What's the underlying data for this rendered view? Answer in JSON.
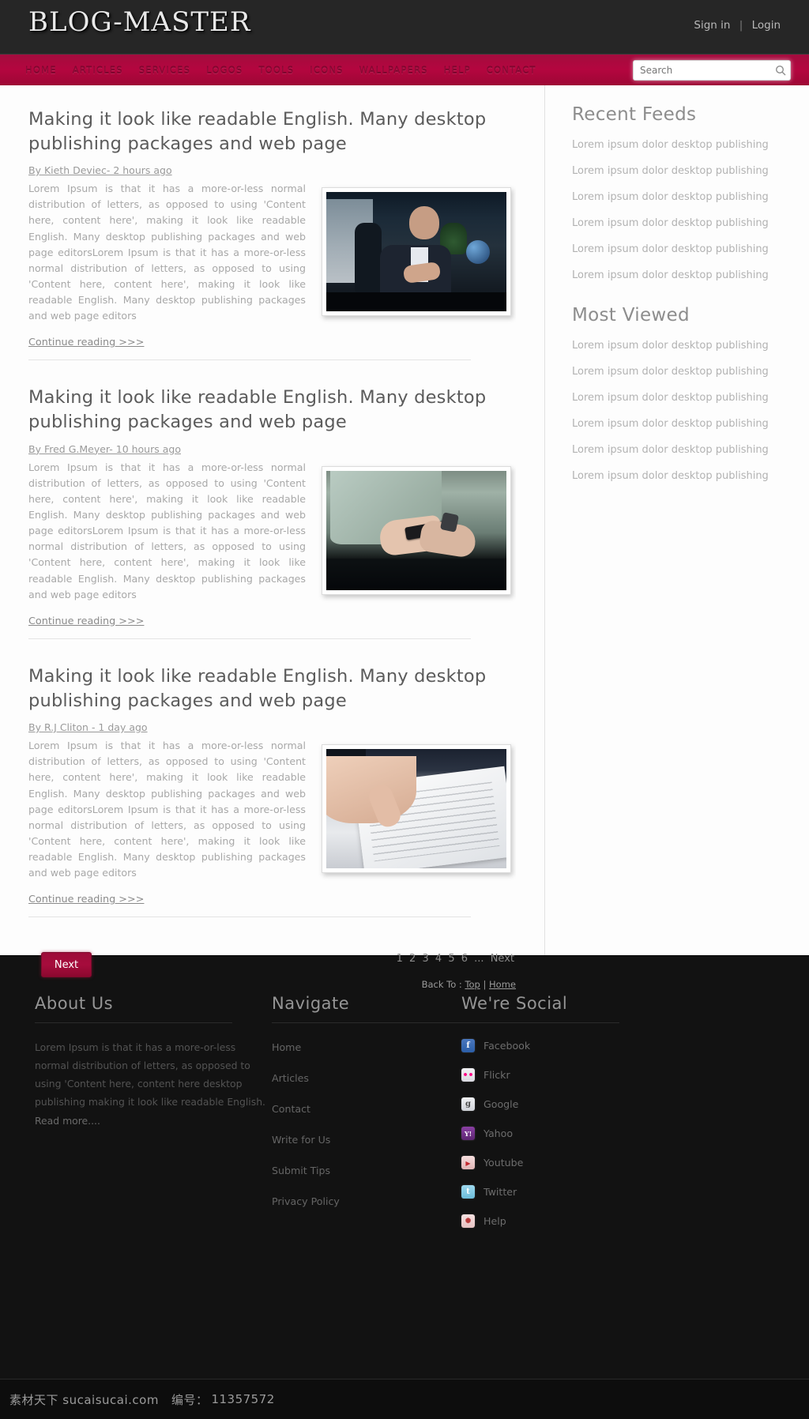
{
  "header": {
    "brand": "BLOG-MASTER",
    "account": {
      "signin": "Sign in",
      "separator": "|",
      "login": "Login"
    }
  },
  "nav": {
    "items": [
      {
        "label": "HOME"
      },
      {
        "label": "ARTICLES"
      },
      {
        "label": "SERVICES"
      },
      {
        "label": "LOGOS"
      },
      {
        "label": "TOOLS"
      },
      {
        "label": "ICONS"
      },
      {
        "label": "WALLPAPERS"
      },
      {
        "label": "HELP"
      },
      {
        "label": "CONTACT"
      }
    ],
    "search": {
      "placeholder": "Search",
      "value": "",
      "icon": "search-icon"
    }
  },
  "posts": [
    {
      "title": "Making it look like readable English. Many desktop publishing packages and web page",
      "byline": "By Kieth Deviec- 2 hours ago",
      "excerpt": "Lorem Ipsum is that it has a more-or-less normal distribution of letters, as opposed to using 'Content here, content here', making it look like readable English. Many desktop publishing packages and web page editorsLorem Ipsum is that it has a more-or-less normal distribution of letters, as opposed to using 'Content here, content here', making it look like readable English. Many desktop publishing packages and web page editors",
      "continue": "Continue reading >>>",
      "image_alt": "businessman-pointing-photo"
    },
    {
      "title": "Making it look like readable English. Many desktop publishing packages and web page",
      "byline": "By Fred G.Meyer- 10 hours ago",
      "excerpt": "Lorem Ipsum is that it has a more-or-less normal distribution of letters, as opposed to using 'Content here, content here', making it look like readable English. Many desktop publishing packages and web page editorsLorem Ipsum is that it has a more-or-less normal distribution of letters, as opposed to using 'Content here, content here', making it look like readable English. Many desktop publishing packages and web page editors",
      "continue": "Continue reading >>>",
      "image_alt": "hands-holding-smartphone-photo"
    },
    {
      "title": "Making it look like readable English. Many desktop publishing packages and web page",
      "byline": "By R.J Cliton - 1 day ago",
      "excerpt": "Lorem Ipsum is that it has a more-or-less normal distribution of letters, as opposed to using 'Content here, content here', making it look like readable English. Many desktop publishing packages and web page editorsLorem Ipsum is that it has a more-or-less normal distribution of letters, as opposed to using 'Content here, content here', making it look like readable English. Many desktop publishing packages and web page editors",
      "continue": "Continue reading >>>",
      "image_alt": "hand-on-document-photo"
    }
  ],
  "pager": {
    "next_button": "Next",
    "pages": [
      "1",
      "2",
      "3",
      "4",
      "5",
      "6",
      "...",
      "Next"
    ],
    "back_to_label": "Back To :",
    "back_to_top": "Top",
    "back_to_sep": "|",
    "back_to_home": "Home"
  },
  "sidebar": {
    "sections": [
      {
        "title": "Recent Feeds",
        "items": [
          "Lorem ipsum dolor desktop publishing",
          "Lorem ipsum dolor desktop publishing",
          "Lorem ipsum dolor desktop publishing",
          "Lorem ipsum dolor desktop publishing",
          "Lorem ipsum dolor desktop publishing",
          "Lorem ipsum dolor desktop publishing"
        ]
      },
      {
        "title": "Most Viewed",
        "items": [
          "Lorem ipsum dolor desktop publishing",
          "Lorem ipsum dolor desktop publishing",
          "Lorem ipsum dolor desktop publishing",
          "Lorem ipsum dolor desktop publishing",
          "Lorem ipsum dolor desktop publishing",
          "Lorem ipsum dolor desktop publishing"
        ]
      }
    ]
  },
  "footer": {
    "about": {
      "title": "About Us",
      "text": "Lorem Ipsum is that it has a more-or-less normal distribution of letters, as opposed to using 'Content here, content here desktop publishing making it look like readable English.",
      "read_more": "Read more...."
    },
    "navigate": {
      "title": "Navigate",
      "items": [
        "Home",
        "Articles",
        "Contact",
        "Write for Us",
        "Submit Tips",
        "Privacy Policy"
      ]
    },
    "social": {
      "title": "We're Social",
      "items": [
        {
          "label": "Facebook",
          "icon": "facebook-icon",
          "glyph": "f",
          "color": "#2b5ea7"
        },
        {
          "label": "Flickr",
          "icon": "flickr-icon",
          "glyph": "••",
          "color": "#e9e9ef"
        },
        {
          "label": "Google",
          "icon": "google-icon",
          "glyph": "g",
          "color": "#dfe1e6"
        },
        {
          "label": "Yahoo",
          "icon": "yahoo-icon",
          "glyph": "Y!",
          "color": "#6a2d7e"
        },
        {
          "label": "Youtube",
          "icon": "youtube-icon",
          "glyph": "▶",
          "color": "#e8c9c9"
        },
        {
          "label": "Twitter",
          "icon": "twitter-icon",
          "glyph": "t",
          "color": "#7fc7e3"
        },
        {
          "label": "Help",
          "icon": "help-icon",
          "glyph": "✺",
          "color": "#efd7d7"
        }
      ]
    }
  },
  "watermark": {
    "site": "素材天下 sucaisucai.com",
    "id_label": "编号：",
    "id_value": "11357572"
  },
  "colors": {
    "accent": "#a60c3c",
    "header_bg": "#262626",
    "footer_bg": "#121212",
    "body_text": "#a8a8a8"
  }
}
